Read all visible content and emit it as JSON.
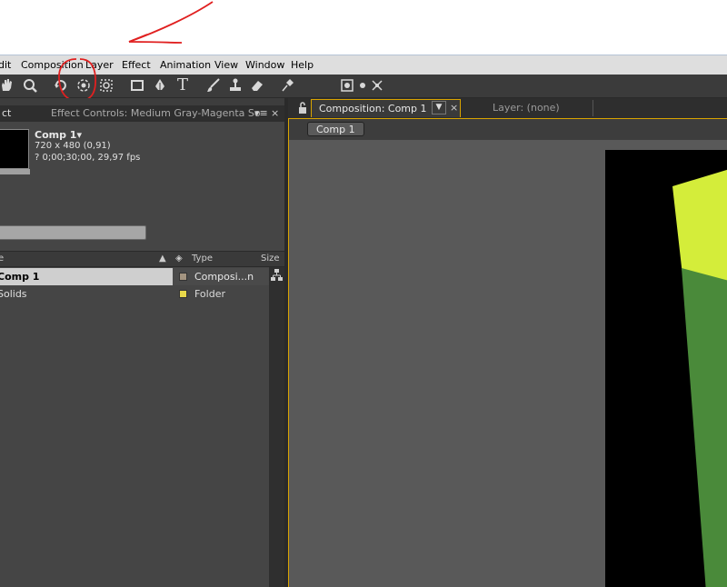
{
  "menu": {
    "items": [
      "dit",
      "Composition",
      "Layer",
      "Effect",
      "Animation",
      "View",
      "Window",
      "Help"
    ]
  },
  "toolbar": {
    "tools": [
      "hand-icon",
      "zoom-icon",
      "rotate-icon",
      "camera-orbit-icon",
      "pan-behind-icon",
      "rectangle-icon",
      "pen-icon",
      "type-icon",
      "brush-icon",
      "clone-stamp-icon",
      "eraser-icon",
      "puppet-pin-icon",
      "local-axis-icon",
      "world-axis-icon",
      "view-axis-icon"
    ],
    "type_glyph": "T"
  },
  "left_panel": {
    "tabs": {
      "project_tab": "ct",
      "effect_controls_tab": "Effect Controls: Medium Gray-Magenta So"
    },
    "selected_item": {
      "name": "Comp 1▾",
      "dimensions": "720 x 480 (0,91)",
      "duration": "? 0;00;30;00, 29,97 fps"
    },
    "search_placeholder": "",
    "columns": {
      "name": "e",
      "type": "Type",
      "size": "Size"
    },
    "rows": [
      {
        "name": "Comp 1",
        "type": "Composi...n",
        "color": "#a39480"
      },
      {
        "name": "Solids",
        "type": "Folder",
        "color": "#e8d84a"
      }
    ]
  },
  "right_panel": {
    "tabs": {
      "composition_tab": "Composition: Comp 1",
      "layer_tab": "Layer: (none)"
    },
    "comp_button": "Comp 1"
  },
  "colors": {
    "accent": "#d9a400",
    "annotation": "#e02020",
    "shape_light": "#d4ed3a",
    "shape_dark": "#4a8a3a"
  }
}
